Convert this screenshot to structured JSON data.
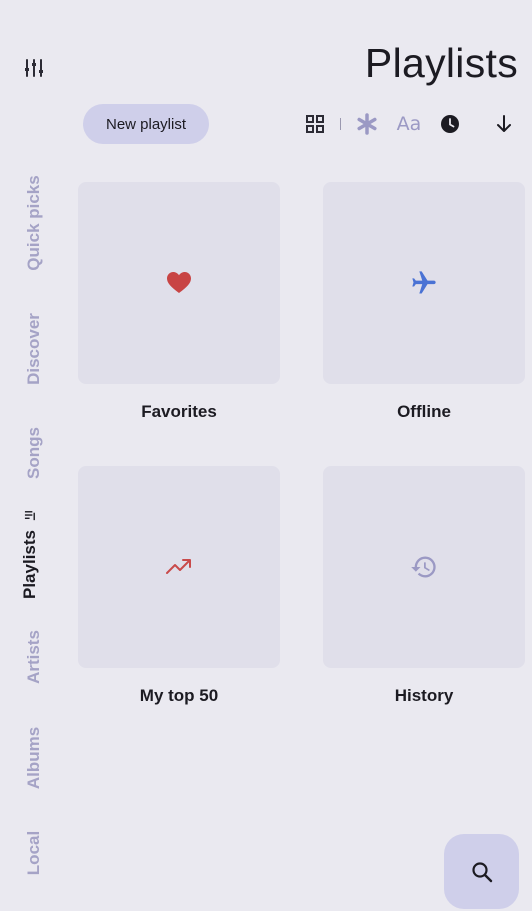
{
  "header": {
    "title": "Playlists"
  },
  "actions": {
    "new_playlist": "New playlist",
    "sort_by_name_label": "Aa"
  },
  "sidebar": {
    "tabs": [
      {
        "label": "Quick picks"
      },
      {
        "label": "Discover"
      },
      {
        "label": "Songs"
      },
      {
        "label": "Playlists",
        "active": true
      },
      {
        "label": "Artists"
      },
      {
        "label": "Albums"
      },
      {
        "label": "Local"
      }
    ]
  },
  "playlists": [
    {
      "name": "Favorites",
      "icon": "heart-icon"
    },
    {
      "name": "Offline",
      "icon": "airplane-icon"
    },
    {
      "name": "My top 50",
      "icon": "trending-up-icon"
    },
    {
      "name": "History",
      "icon": "history-icon"
    }
  ],
  "colors": {
    "accent": "#cfcfea",
    "inactive_tab": "#a5a3c6",
    "heart": "#c84444",
    "airplane": "#4a72d4",
    "trending": "#c94a4a",
    "history": "#9b99c4"
  }
}
